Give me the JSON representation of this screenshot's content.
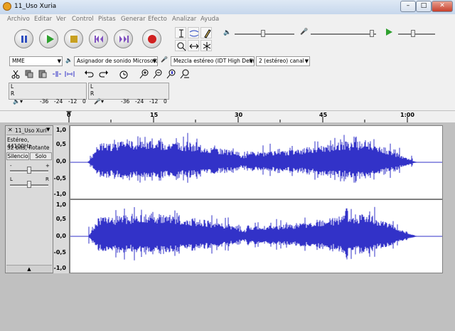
{
  "window": {
    "title": "11_Uso Xuria",
    "minimize": "–",
    "maximize": "□",
    "close": "✕"
  },
  "menu": [
    "Archivo",
    "Editar",
    "Ver",
    "Control",
    "Pistas",
    "Generar",
    "Efecto",
    "Analizar",
    "Ayuda"
  ],
  "transport": {
    "buttons": [
      {
        "name": "pause-button",
        "icon": "pause-icon",
        "color": "#3050c0"
      },
      {
        "name": "play-button",
        "icon": "play-icon",
        "color": "#2ea02e"
      },
      {
        "name": "stop-button",
        "icon": "stop-icon",
        "color": "#c8a020"
      },
      {
        "name": "skip-start-button",
        "icon": "skip-start-icon",
        "color": "#8050c0"
      },
      {
        "name": "skip-end-button",
        "icon": "skip-end-icon",
        "color": "#8050c0"
      },
      {
        "name": "record-button",
        "icon": "record-icon",
        "color": "#d02020"
      }
    ]
  },
  "devices": {
    "host": "MME",
    "output": "Asignador de sonido Microsoft",
    "input": "Mezcla estéreo (IDT High Defin",
    "channels": "2 (estéreo) canal"
  },
  "meters": {
    "left": "L",
    "right": "R",
    "scale": [
      "-36",
      "-24",
      "-12",
      "0"
    ]
  },
  "ruler": {
    "labels": [
      "0",
      "15",
      "30",
      "45",
      "1:00"
    ]
  },
  "track": {
    "name": "11_Uso Xuri",
    "format": "Estéreo, 44100Hz",
    "bits": "32 bits, flotante",
    "mute": "Silencio",
    "solo": "Solo",
    "gain_minus": "-",
    "gain_plus": "+",
    "pan_left": "L",
    "pan_right": "R",
    "axis": [
      "1,0",
      "0,5",
      "0,0",
      "-0,5",
      "-1,0"
    ],
    "wave_color": "#3232c8"
  }
}
